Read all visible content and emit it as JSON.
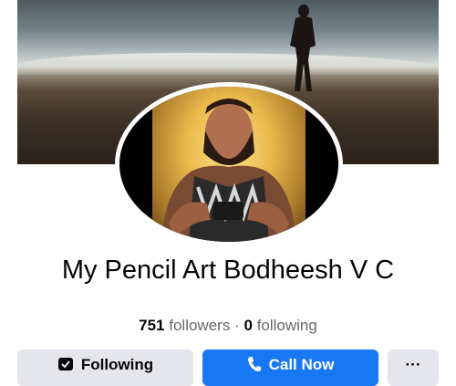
{
  "page": {
    "name": "My Pencil Art Bodheesh V C",
    "followers_count": "751",
    "followers_label": "followers",
    "separator": "·",
    "following_count": "0",
    "following_label": "following"
  },
  "actions": {
    "following_label": "Following",
    "call_label": "Call Now",
    "more_label": "···"
  },
  "icons": {
    "following": "following-check-icon",
    "call": "phone-icon",
    "more": "more-dots-icon"
  },
  "colors": {
    "primary": "#1877f2",
    "secondary_bg": "#e4e6eb",
    "text": "#050505",
    "muted": "#65676b"
  }
}
